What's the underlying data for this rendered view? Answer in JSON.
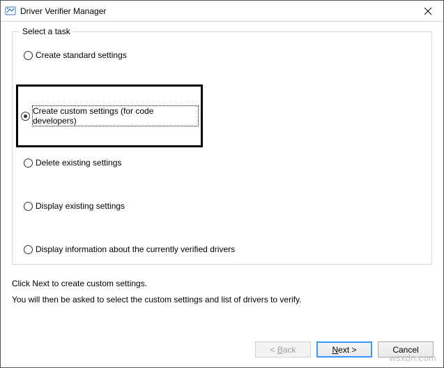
{
  "window": {
    "title": "Driver Verifier Manager"
  },
  "group": {
    "label": "Select a task",
    "options": [
      {
        "label": "Create standard settings",
        "checked": false
      },
      {
        "label": "Create custom settings (for code developers)",
        "checked": true
      },
      {
        "label": "Delete existing settings",
        "checked": false
      },
      {
        "label": "Display existing settings",
        "checked": false
      },
      {
        "label": "Display information about the currently verified drivers",
        "checked": false
      }
    ]
  },
  "instructions": {
    "line1": "Click Next to create custom settings.",
    "line2": "You will then be asked to select the custom settings and list of drivers to verify."
  },
  "buttons": {
    "back": "< Back",
    "next": "Next >",
    "cancel": "Cancel"
  },
  "watermark": "wsxdn.com"
}
